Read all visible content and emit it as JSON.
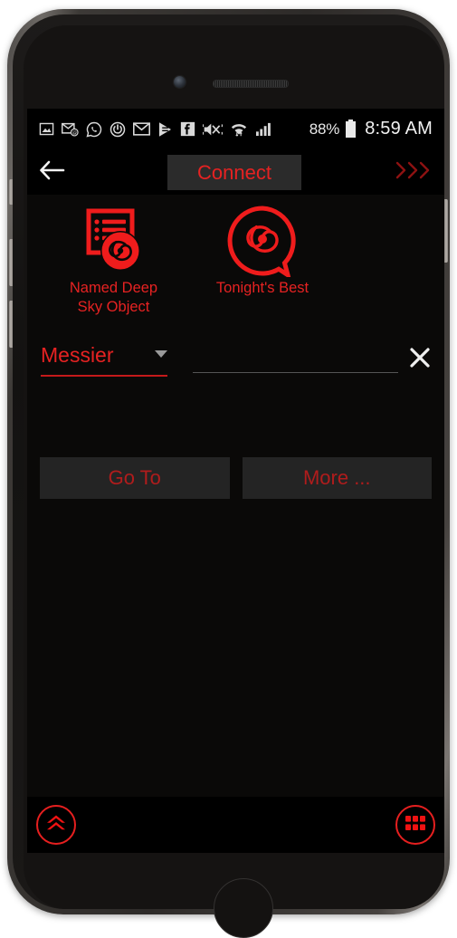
{
  "status_bar": {
    "icons": [
      "image-icon",
      "email-at-icon",
      "whatsapp-icon",
      "alarm-power-icon",
      "envelope-icon",
      "play-store-icon",
      "facebook-icon",
      "volume-vibrate-muted-icon",
      "wifi-icon",
      "cellular-signal-icon"
    ],
    "battery_percent": "88%",
    "battery_icon": "battery-icon",
    "clock": "8:59 AM"
  },
  "nav_bar": {
    "back_icon": "back-arrow-icon",
    "connect_label": "Connect",
    "expand_icon": "triple-chevron-right-icon"
  },
  "modes": [
    {
      "label": "Named Deep\nSky Object",
      "line1": "Named Deep",
      "line2": "Sky Object",
      "icon": "list-galaxy-icon"
    },
    {
      "label": "Tonight's Best",
      "line1": "Tonight's Best",
      "line2": "",
      "icon": "galaxy-bubble-icon"
    }
  ],
  "search": {
    "catalog_selected": "Messier",
    "catalog_caret_icon": "chevron-down-icon",
    "object_value": "",
    "object_placeholder": "",
    "clear_icon": "close-x-icon"
  },
  "actions": {
    "goto_label": "Go To",
    "more_label": "More ..."
  },
  "bottom_bar": {
    "expand_up_icon": "double-chevron-up-circle-icon",
    "grid_menu_icon": "grid-menu-circle-icon"
  },
  "colors": {
    "accent_red": "#e62222",
    "dim_red": "#b01c1c",
    "screen_bg": "#0a0908",
    "button_bg": "#242424"
  }
}
